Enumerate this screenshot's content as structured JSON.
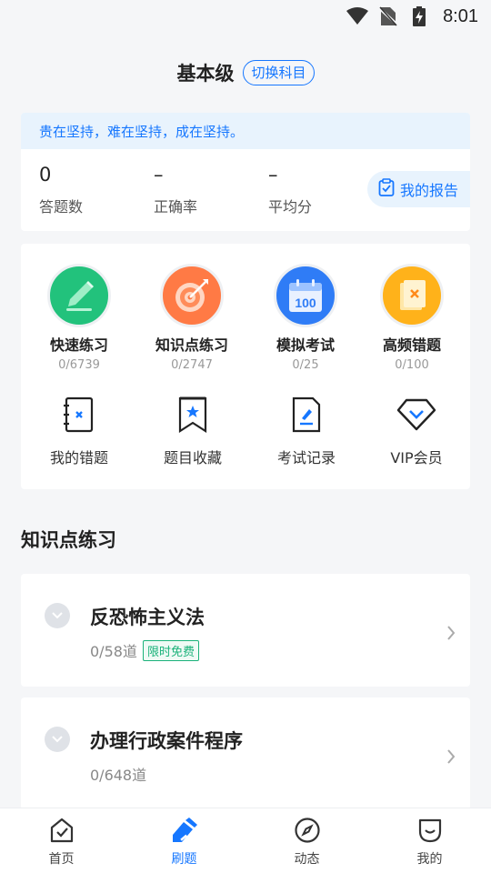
{
  "status_bar": {
    "time": "8:01"
  },
  "header": {
    "title": "基本级",
    "switch_label": "切换科目"
  },
  "motto": "贵在坚持，难在坚持，成在坚持。",
  "stats": [
    {
      "value": "0",
      "label": "答题数"
    },
    {
      "value": "–",
      "label": "正确率"
    },
    {
      "value": "–",
      "label": "平均分"
    }
  ],
  "report_button": "我的报告",
  "features": [
    {
      "name": "快速练习",
      "count": "0/6739",
      "icon": "pencil-icon",
      "color": "#22c27c"
    },
    {
      "name": "知识点练习",
      "count": "0/2747",
      "icon": "target-icon",
      "color": "#ff7a45"
    },
    {
      "name": "模拟考试",
      "count": "0/25",
      "icon": "calendar-100-icon",
      "color": "#2f7cf6"
    },
    {
      "name": "高频错题",
      "count": "0/100",
      "icon": "wrong-book-icon",
      "color": "#ffb21a"
    }
  ],
  "tools": [
    {
      "name": "我的错题",
      "icon": "wrong-questions-icon"
    },
    {
      "name": "题目收藏",
      "icon": "bookmark-icon"
    },
    {
      "name": "考试记录",
      "icon": "exam-record-icon"
    },
    {
      "name": "VIP会员",
      "icon": "diamond-icon"
    }
  ],
  "calendar_number": "100",
  "section_title": "知识点练习",
  "lessons": [
    {
      "title": "反恐怖主义法",
      "progress": "0/58道",
      "badge": "限时免费"
    },
    {
      "title": "办理行政案件程序",
      "progress": "0/648道",
      "badge": ""
    }
  ],
  "tabs": [
    {
      "label": "首页",
      "icon": "home-check-icon",
      "active": false
    },
    {
      "label": "刷题",
      "icon": "brush-icon",
      "active": true
    },
    {
      "label": "动态",
      "icon": "compass-icon",
      "active": false
    },
    {
      "label": "我的",
      "icon": "profile-icon",
      "active": false
    }
  ],
  "colors": {
    "accent": "#1677ff",
    "free_badge": "#1bb27a"
  }
}
